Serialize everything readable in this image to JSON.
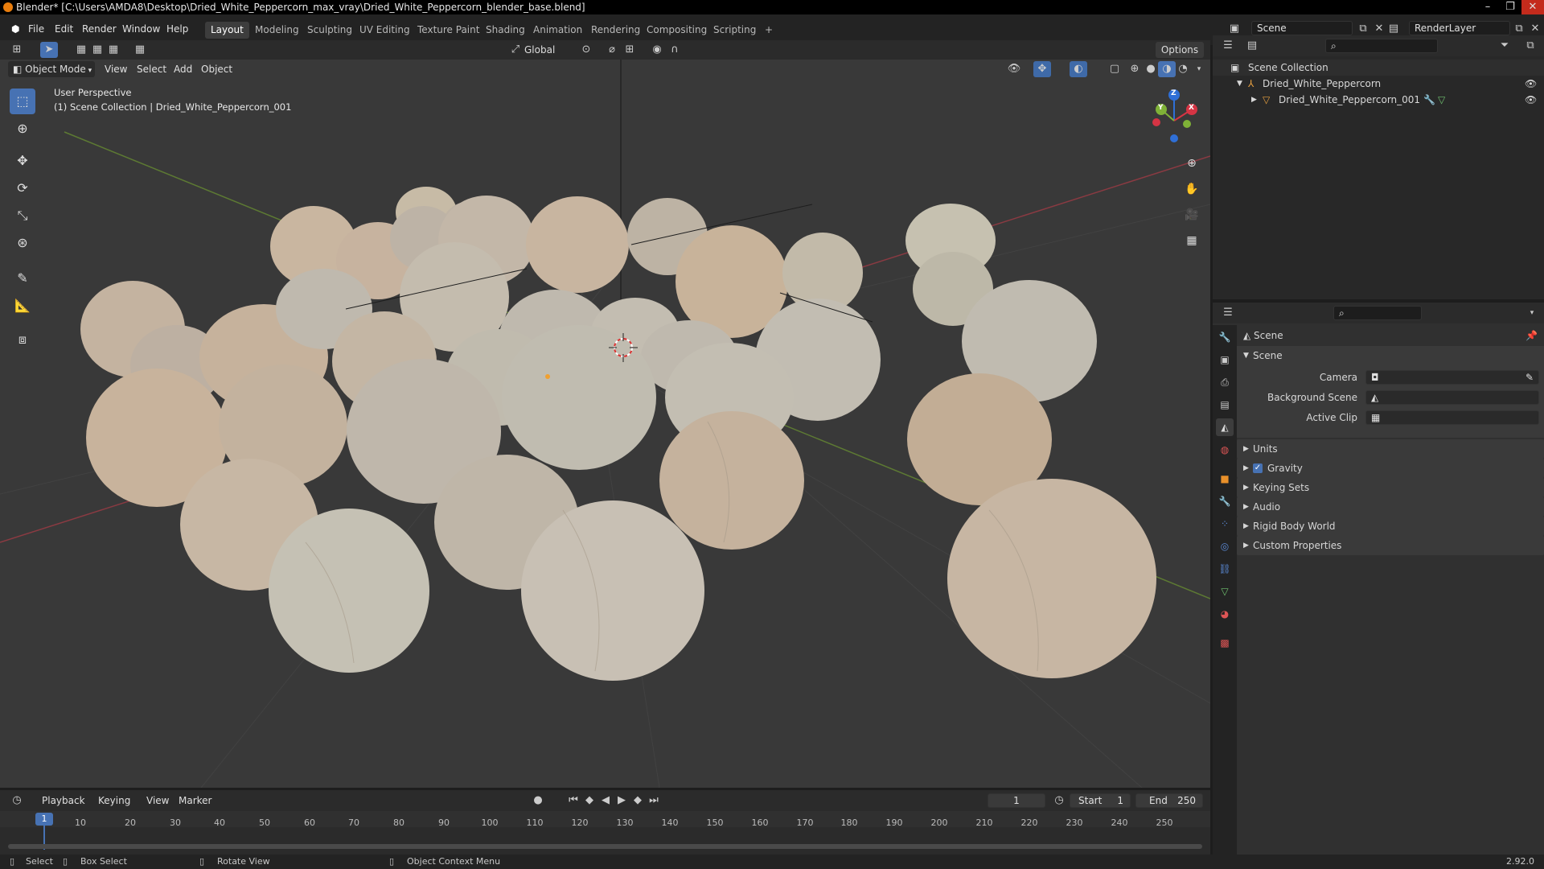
{
  "window": {
    "title": "Blender* [C:\\Users\\AMDA8\\Desktop\\Dried_White_Peppercorn_max_vray\\Dried_White_Peppercorn_blender_base.blend]"
  },
  "menu": [
    "File",
    "Edit",
    "Render",
    "Window",
    "Help"
  ],
  "workspaces": [
    "Layout",
    "Modeling",
    "Sculpting",
    "UV Editing",
    "Texture Paint",
    "Shading",
    "Animation",
    "Rendering",
    "Compositing",
    "Scripting",
    "+"
  ],
  "active_workspace": "Layout",
  "scene_field": "Scene",
  "renderlayer_field": "RenderLayer",
  "viewport": {
    "transform_orientation": "Global",
    "options_label": "Options",
    "mode": "Object Mode",
    "header_menu": [
      "View",
      "Select",
      "Add",
      "Object"
    ],
    "overlay_line1": "User Perspective",
    "overlay_line2": "(1) Scene Collection | Dried_White_Peppercorn_001",
    "gizmo_labels": {
      "z": "Z",
      "y": "Y",
      "x": "X"
    }
  },
  "outliner": {
    "root": "Scene Collection",
    "items": [
      {
        "name": "Dried_White_Peppercorn",
        "level": 1
      },
      {
        "name": "Dried_White_Peppercorn_001",
        "level": 2
      }
    ]
  },
  "properties": {
    "context": "Scene",
    "section": "Scene",
    "fields": [
      {
        "label": "Camera",
        "value": ""
      },
      {
        "label": "Background Scene",
        "value": ""
      },
      {
        "label": "Active Clip",
        "value": ""
      }
    ],
    "panels": [
      {
        "label": "Units",
        "checkbox": false
      },
      {
        "label": "Gravity",
        "checkbox": true
      },
      {
        "label": "Keying Sets",
        "checkbox": false
      },
      {
        "label": "Audio",
        "checkbox": false
      },
      {
        "label": "Rigid Body World",
        "checkbox": false
      },
      {
        "label": "Custom Properties",
        "checkbox": false
      }
    ]
  },
  "timeline": {
    "menu": [
      "Playback",
      "Keying",
      "View",
      "Marker"
    ],
    "current_frame": "1",
    "start_label": "Start",
    "start": "1",
    "end_label": "End",
    "end": "250",
    "ticks": [
      "1",
      "10",
      "20",
      "30",
      "40",
      "50",
      "60",
      "70",
      "80",
      "90",
      "100",
      "110",
      "120",
      "130",
      "140",
      "150",
      "160",
      "170",
      "180",
      "190",
      "200",
      "210",
      "220",
      "230",
      "240",
      "250"
    ]
  },
  "status": {
    "select": "Select",
    "box_select": "Box Select",
    "rotate_view": "Rotate View",
    "context_menu": "Object Context Menu",
    "version": "2.92.0"
  },
  "colors": {
    "accent": "#4772b3",
    "x_axis": "#d53444",
    "y_axis": "#7fb237",
    "z_axis": "#2f6fd6"
  }
}
